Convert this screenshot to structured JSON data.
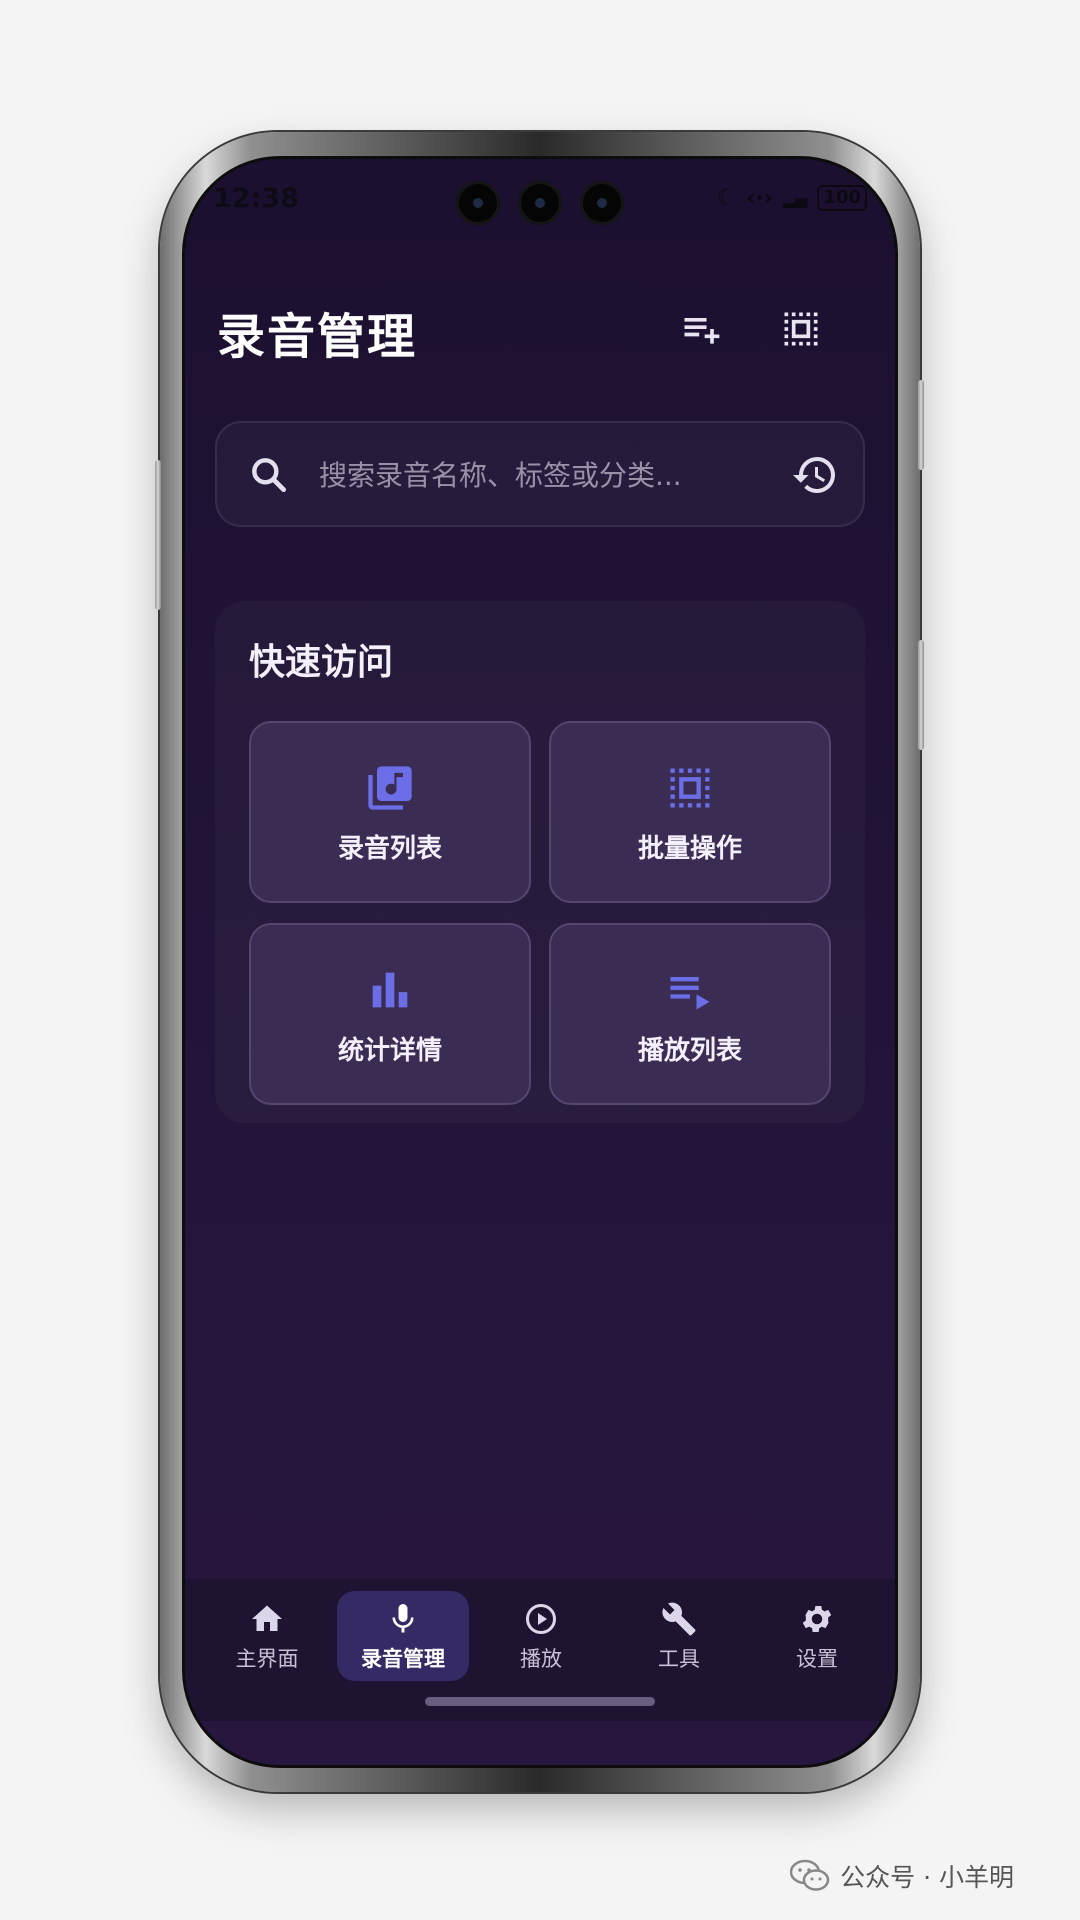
{
  "status_bar": {
    "time": "12:38",
    "battery": "100",
    "icons": [
      "moon-icon",
      "data-transfer-icon",
      "signal-icon",
      "battery-icon"
    ]
  },
  "header": {
    "title": "录音管理",
    "actions": [
      {
        "icon": "playlist-add-icon"
      },
      {
        "icon": "select-all-icon"
      }
    ]
  },
  "search": {
    "placeholder": "搜索录音名称、标签或分类...",
    "value": "",
    "left_icon": "search-icon",
    "right_icon": "history-icon"
  },
  "quick_access": {
    "title": "快速访问",
    "items": [
      {
        "label": "录音列表",
        "icon": "music-library-icon"
      },
      {
        "label": "批量操作",
        "icon": "select-all-icon"
      },
      {
        "label": "统计详情",
        "icon": "bar-chart-icon"
      },
      {
        "label": "播放列表",
        "icon": "playlist-play-icon"
      }
    ]
  },
  "bottom_nav": {
    "items": [
      {
        "label": "主界面",
        "icon": "home-icon",
        "active": false
      },
      {
        "label": "录音管理",
        "icon": "microphone-icon",
        "active": true
      },
      {
        "label": "播放",
        "icon": "play-circle-icon",
        "active": false
      },
      {
        "label": "工具",
        "icon": "wrench-icon",
        "active": false
      },
      {
        "label": "设置",
        "icon": "gear-icon",
        "active": false
      }
    ]
  },
  "watermark": {
    "text": "公众号 · 小羊明",
    "icon": "wechat-icon"
  },
  "colors": {
    "screen_bg": "#211437",
    "tile_bg": "#3a2c52",
    "accent_icon": "#6b6ee6",
    "active_nav": "#352a63",
    "text_primary": "#ffffff"
  }
}
